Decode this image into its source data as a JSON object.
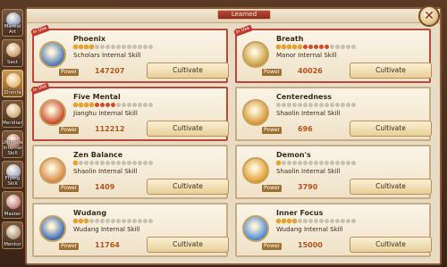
{
  "header": {
    "tab_label": "Learned"
  },
  "sidebar": {
    "items": [
      {
        "label": "Martial\nArt",
        "icon": "martial-art-icon",
        "color": "#5a7ab8",
        "active": false
      },
      {
        "label": "Sect",
        "icon": "sect-icon",
        "color": "#b8743a",
        "active": false
      },
      {
        "label": "Zhenfa",
        "icon": "zhenfa-icon",
        "color": "#d8a04a",
        "active": true
      },
      {
        "label": "Meridian",
        "icon": "meridian-icon",
        "color": "#c08a4a",
        "active": false
      },
      {
        "label": "Ultimate\nInternal Skill",
        "icon": "ultimate-skill-icon",
        "color": "#b84a3a",
        "active": false
      },
      {
        "label": "Flying Skill",
        "icon": "flying-skill-icon",
        "color": "#7a8ab8",
        "active": false
      },
      {
        "label": "Master",
        "icon": "master-icon",
        "color": "#a84a5a",
        "active": false
      },
      {
        "label": "Mentor",
        "icon": "mentor-icon",
        "color": "#8a6a4a",
        "active": false
      }
    ]
  },
  "skills": [
    {
      "name": "Phoenix",
      "type": "Scholars Internal Skill",
      "power_label": "Power",
      "power": "147207",
      "button": "Cultivate",
      "tag": "In Use",
      "highlight": true,
      "icon_color": "#4a7ab8",
      "stars_on": 4,
      "stars_red": 0
    },
    {
      "name": "Breath",
      "type": "Manor Internal Skill",
      "power_label": "Power",
      "power": "40026",
      "button": "Cultivate",
      "tag": "In Use",
      "highlight": true,
      "icon_color": "#c8a040",
      "stars_on": 5,
      "stars_red": 5
    },
    {
      "name": "Five Mental",
      "type": "Jianghu Internal Skill",
      "power_label": "Power",
      "power": "112212",
      "button": "Cultivate",
      "tag": "In Use",
      "highlight": true,
      "icon_color": "#c84a2a",
      "stars_on": 4,
      "stars_red": 4
    },
    {
      "name": "Centeredness",
      "type": "Shaolin Internal Skill",
      "power_label": "Power",
      "power": "696",
      "button": "Cultivate",
      "tag": "",
      "highlight": false,
      "icon_color": "#d89a3a",
      "stars_on": 0,
      "stars_red": 0
    },
    {
      "name": "Zen Balance",
      "type": "Shaolin Internal Skill",
      "power_label": "Power",
      "power": "1409",
      "button": "Cultivate",
      "tag": "",
      "highlight": false,
      "icon_color": "#d88a4a",
      "stars_on": 1,
      "stars_red": 0
    },
    {
      "name": "Demon's",
      "type": "Shaolin Internal Skill",
      "power_label": "Power",
      "power": "3790",
      "button": "Cultivate",
      "tag": "",
      "highlight": false,
      "icon_color": "#e0a030",
      "stars_on": 1,
      "stars_red": 0
    },
    {
      "name": "Wudang",
      "type": "Wudang Internal Skill",
      "power_label": "Power",
      "power": "11764",
      "button": "Cultivate",
      "tag": "",
      "highlight": false,
      "icon_color": "#3a6ab8",
      "stars_on": 3,
      "stars_red": 0
    },
    {
      "name": "Inner Focus",
      "type": "Wudang Internal Skill",
      "power_label": "Power",
      "power": "15000",
      "button": "Cultivate",
      "tag": "",
      "highlight": false,
      "icon_color": "#4a8ad8",
      "stars_on": 4,
      "stars_red": 0
    }
  ]
}
